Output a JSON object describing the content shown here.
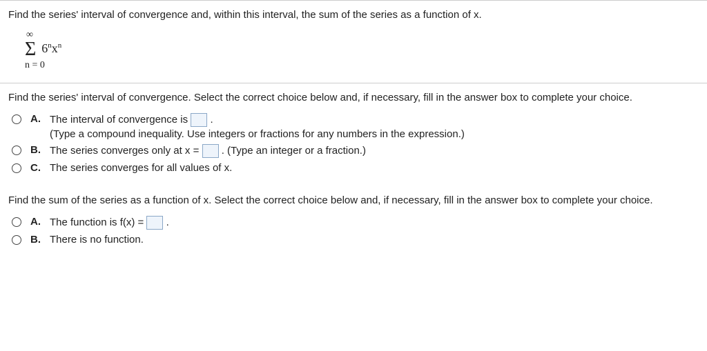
{
  "q": {
    "prompt": "Find the series' interval of convergence and, within this interval, the sum of the series as a function of x.",
    "sigma": {
      "top": "∞",
      "sym": "Σ",
      "term_base1": "6",
      "term_sup1": "n",
      "term_base2": "x",
      "term_sup2": "n",
      "bottom": "n = 0"
    }
  },
  "p1": {
    "instr": "Find the series' interval of convergence. Select the correct choice below and, if necessary, fill in the answer box to complete your choice.",
    "A": {
      "lbl": "A.",
      "pre": "The interval of convergence is ",
      "post": " .",
      "hint": "(Type a compound inequality. Use integers or fractions for any numbers in the expression.)"
    },
    "B": {
      "lbl": "B.",
      "pre": "The series converges only at x = ",
      "post": " . (Type an integer or a fraction.)"
    },
    "C": {
      "lbl": "C.",
      "txt": "The series converges for all values of x."
    }
  },
  "p2": {
    "instr": "Find the sum of the series as a function of x. Select the correct choice below and, if necessary, fill in the answer box to complete your choice.",
    "A": {
      "lbl": "A.",
      "pre": "The function is f(x) = ",
      "post": " ."
    },
    "B": {
      "lbl": "B.",
      "txt": "There is no function."
    }
  }
}
